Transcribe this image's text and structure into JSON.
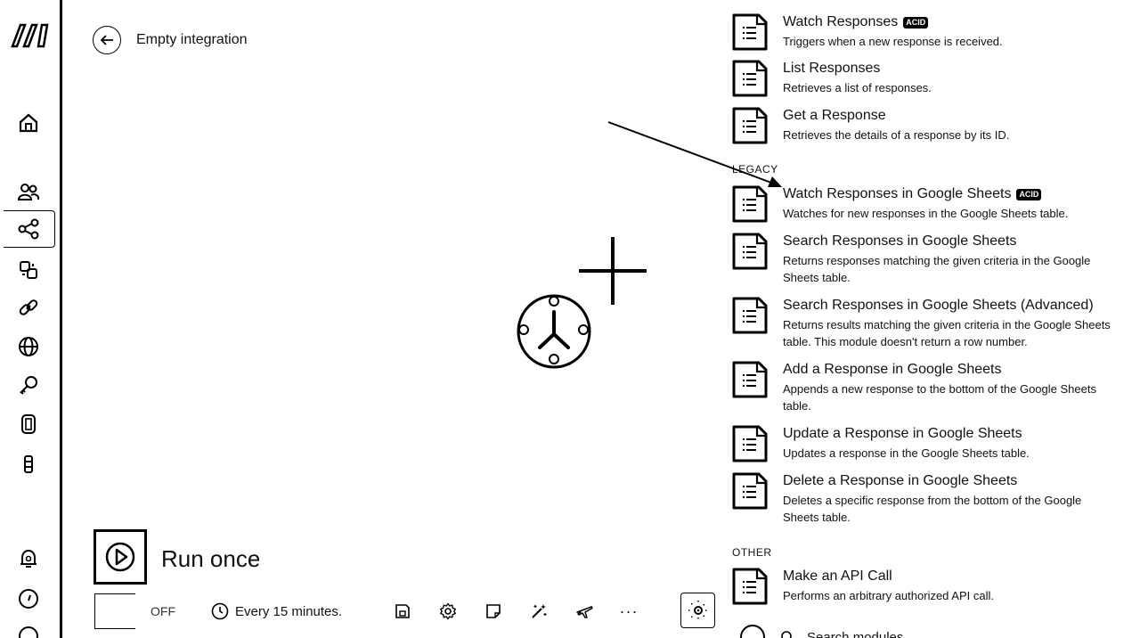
{
  "header": {
    "title": "Empty integration"
  },
  "run": {
    "label": "Run once"
  },
  "toolbar": {
    "toggle_state": "OFF",
    "schedule": "Every 15 minutes.",
    "more": "···"
  },
  "panel": {
    "modules": [
      {
        "title": "Watch Responses",
        "badge": "ACID",
        "desc": "Triggers when a new response is received."
      },
      {
        "title": "List Responses",
        "badge": "",
        "desc": "Retrieves a list of responses."
      },
      {
        "title": "Get a Response",
        "badge": "",
        "desc": "Retrieves the details of a response by its ID."
      }
    ],
    "legacy_label": "LEGACY",
    "legacy_modules": [
      {
        "title": "Watch Responses in Google Sheets",
        "badge": "ACID",
        "desc": "Watches for new responses in the Google Sheets table."
      },
      {
        "title": "Search Responses in Google Sheets",
        "badge": "",
        "desc": "Returns responses matching the given criteria in the Google Sheets table."
      },
      {
        "title": "Search Responses in Google Sheets (Advanced)",
        "badge": "",
        "desc": "Returns results matching the given criteria in the Google Sheets table. This module doesn't return a row number."
      },
      {
        "title": "Add a Response in Google Sheets",
        "badge": "",
        "desc": "Appends a new response to the bottom of the Google Sheets table."
      },
      {
        "title": "Update a Response in Google Sheets",
        "badge": "",
        "desc": "Updates a response in the Google Sheets table."
      },
      {
        "title": "Delete a Response in Google Sheets",
        "badge": "",
        "desc": "Deletes a specific response from the bottom of the Google Sheets table."
      }
    ],
    "other_label": "OTHER",
    "other_modules": [
      {
        "title": "Make an API Call",
        "badge": "",
        "desc": "Performs an arbitrary authorized API call."
      }
    ],
    "search_placeholder": "Search modules"
  },
  "icons": {
    "sidebar": [
      "home-icon",
      "team-icon",
      "share-icon",
      "templates-icon",
      "connections-icon",
      "webhooks-icon",
      "keys-icon",
      "devices-icon",
      "datastore-icon",
      "notifications-icon",
      "help-icon",
      "profile-icon"
    ],
    "module": "forms-document-icon"
  }
}
